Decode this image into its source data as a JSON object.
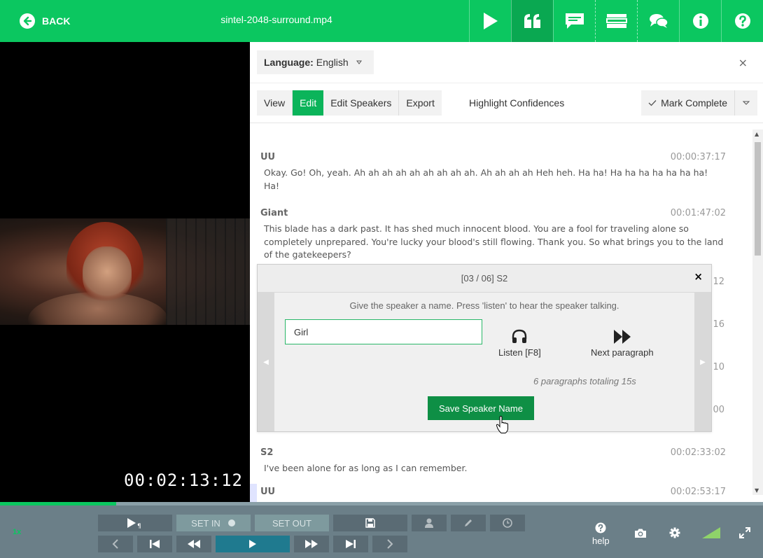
{
  "topbar": {
    "back_label": "BACK",
    "file_title": "sintel-2048-surround.mp4",
    "icons": [
      "play-icon",
      "quote-icon",
      "caption-icon",
      "layout-icon",
      "chat-icon",
      "info-icon",
      "help-icon"
    ]
  },
  "video": {
    "timecode": "00:02:13:12"
  },
  "panel": {
    "language_label": "Language:",
    "language_value": "English",
    "close": "×",
    "tabs": {
      "view": "View",
      "edit": "Edit",
      "edit_speakers": "Edit Speakers",
      "export": "Export",
      "highlight": "Highlight Confidences"
    },
    "mark_complete": "Mark Complete"
  },
  "transcript": {
    "p1": {
      "speaker": "UU",
      "time": "00:00:37:17",
      "text": "Okay. Go! Oh, yeah. Ah ah ah ah ah ah ah ah ah. Ah ah ah ah Heh heh. Ha ha! Ha ha ha ha ha ha ha! Ha!"
    },
    "p2": {
      "speaker": "Giant",
      "time": "00:01:47:02",
      "text": "This blade has a dark past. It has shed much innocent blood. You are a fool for traveling alone so completely unprepared. You're lucky your blood's still flowing. Thank you. So what brings you to the land of the gatekeepers?"
    },
    "peeks": [
      "12",
      "16",
      "10",
      "00"
    ],
    "p3": {
      "speaker": "S2",
      "time": "00:02:33:02",
      "text": "I've been alone for as long as I can remember."
    },
    "p4": {
      "speaker": "UU",
      "time": "00:02:53:17"
    }
  },
  "popup": {
    "header": "[03 / 06] S2",
    "close": "×",
    "hint": "Give the speaker a name. Press 'listen' to hear the speaker talking.",
    "input_value": "Girl",
    "listen_label": "Listen [F8]",
    "next_label": "Next paragraph",
    "summary": "6 paragraphs totaling 15s",
    "save_label": "Save Speaker Name"
  },
  "progress": {
    "fraction": 0.152
  },
  "controls": {
    "speed": "1x",
    "set_in": "SET IN",
    "set_out": "SET OUT",
    "help": "help"
  },
  "colors": {
    "brand": "#0bc760",
    "active_tab": "#0bb45a",
    "save_button": "#0e8f45",
    "controls_bg": "#6b7f88"
  }
}
